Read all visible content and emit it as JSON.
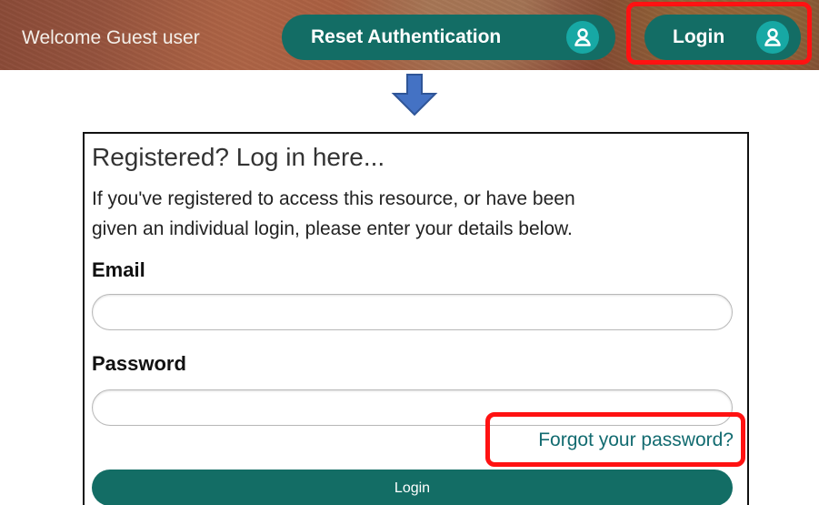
{
  "top_bar": {
    "welcome_text": "Welcome Guest user",
    "reset_authentication_label": "Reset Authentication",
    "login_label": "Login",
    "icon": "user-icon",
    "highlight_color": "#ff1212"
  },
  "transition": {
    "arrow_icon": "down-arrow-icon",
    "arrow_color": "#4472c4"
  },
  "login_form": {
    "title": "Registered? Log in here...",
    "intro_line_1": "If you've registered to access this resource, or have been",
    "intro_line_2": "given an individual login, please enter your details below.",
    "email_label": "Email",
    "email_value": "",
    "email_placeholder": "",
    "password_label": "Password",
    "password_value": "",
    "password_placeholder": "",
    "forgot_password_link": "Forgot your password?",
    "submit_label": "Login",
    "primary_color": "#136d65",
    "link_color": "#126b70"
  }
}
